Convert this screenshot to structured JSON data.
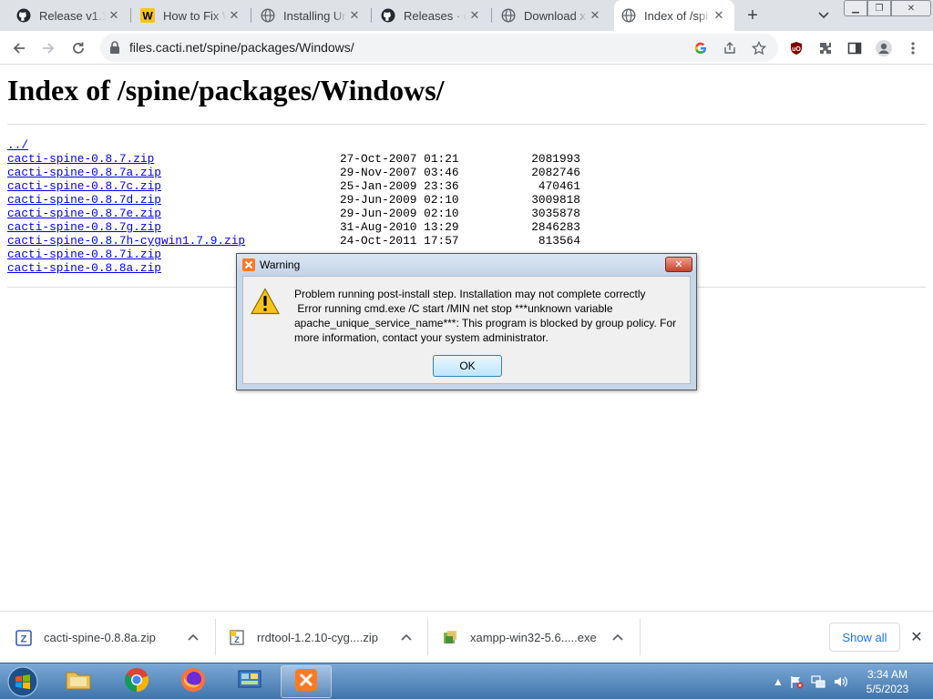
{
  "browser": {
    "tabs": [
      {
        "title": "Release v1.1",
        "icon": "github-icon"
      },
      {
        "title": "How to Fix W",
        "icon": "w-logo-icon"
      },
      {
        "title": "Installing Un",
        "icon": "globe-icon"
      },
      {
        "title": "Releases · ce",
        "icon": "github-icon"
      },
      {
        "title": "Download xa",
        "icon": "globe-icon"
      },
      {
        "title": "Index of /spi",
        "icon": "globe-icon"
      }
    ],
    "address": "files.cacti.net/spine/packages/Windows/"
  },
  "page": {
    "heading": "Index of /spine/packages/Windows/",
    "parent_link": "../",
    "files": [
      {
        "name": "cacti-spine-0.8.7.zip",
        "date": "27-Oct-2007 01:21",
        "size": "2081993"
      },
      {
        "name": "cacti-spine-0.8.7a.zip",
        "date": "29-Nov-2007 03:46",
        "size": "2082746"
      },
      {
        "name": "cacti-spine-0.8.7c.zip",
        "date": "25-Jan-2009 23:36",
        "size": "470461"
      },
      {
        "name": "cacti-spine-0.8.7d.zip",
        "date": "29-Jun-2009 02:10",
        "size": "3009818"
      },
      {
        "name": "cacti-spine-0.8.7e.zip",
        "date": "29-Jun-2009 02:10",
        "size": "3035878"
      },
      {
        "name": "cacti-spine-0.8.7g.zip",
        "date": "31-Aug-2010 13:29",
        "size": "2846283"
      },
      {
        "name": "cacti-spine-0.8.7h-cygwin1.7.9.zip",
        "date": "24-Oct-2011 17:57",
        "size": "813564"
      },
      {
        "name": "cacti-spine-0.8.7i.zip",
        "date": "",
        "size": ""
      },
      {
        "name": "cacti-spine-0.8.8a.zip",
        "date": "",
        "size": ""
      }
    ]
  },
  "dialog": {
    "title": "Warning",
    "message_lines": [
      "Problem running post-install step. Installation may not complete correctly",
      " Error running cmd.exe /C start /MIN net stop ***unknown variable",
      "apache_unique_service_name***: This program is blocked by group policy. For",
      "more information, contact your system administrator."
    ],
    "ok_label": "OK"
  },
  "downloads": {
    "items": [
      {
        "name": "cacti-spine-0.8.8a.zip"
      },
      {
        "name": "rrdtool-1.2.10-cyg....zip"
      },
      {
        "name": "xampp-win32-5.6.....exe"
      }
    ],
    "show_all": "Show all"
  },
  "taskbar": {
    "time": "3:34 AM",
    "date": "5/5/2023"
  }
}
